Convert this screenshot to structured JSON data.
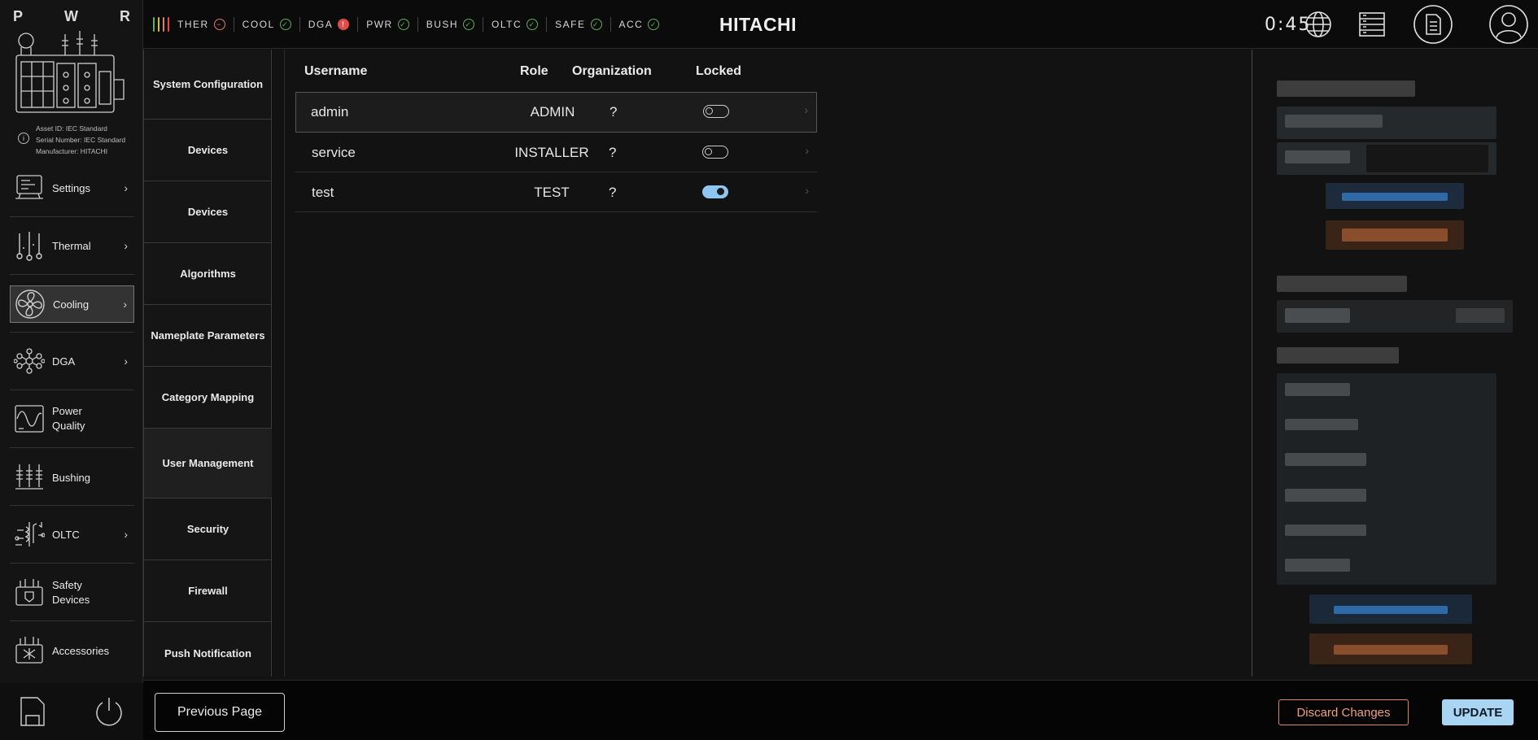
{
  "header": {
    "brand": "HITACHI",
    "timer": "0:45",
    "bar_colors": [
      "#5fae5a",
      "#c9c048",
      "#e07b66",
      "#e34a4a"
    ],
    "statuses": [
      {
        "label": "THER",
        "state": "warn",
        "glyph": "−"
      },
      {
        "label": "COOL",
        "state": "ok",
        "glyph": "✓"
      },
      {
        "label": "DGA",
        "state": "alert",
        "glyph": "!"
      },
      {
        "label": "PWR",
        "state": "ok",
        "glyph": "✓"
      },
      {
        "label": "BUSH",
        "state": "ok",
        "glyph": "✓"
      },
      {
        "label": "OLTC",
        "state": "ok",
        "glyph": "✓"
      },
      {
        "label": "SAFE",
        "state": "ok",
        "glyph": "✓"
      },
      {
        "label": "ACC",
        "state": "ok",
        "glyph": "✓"
      }
    ],
    "icons": [
      "globe-icon",
      "server-icon",
      "document-icon",
      "user-icon"
    ]
  },
  "asset": {
    "letters": [
      "P",
      "W",
      "R"
    ],
    "asset_id": "Asset ID: IEC Standard",
    "serial": "Serial Number: IEC Standard",
    "manufacturer": "Manufacturer: HITACHI"
  },
  "nav": {
    "items": [
      {
        "label": "Settings",
        "icon": "settings-icon",
        "chevron": true
      },
      {
        "label": "Thermal",
        "icon": "thermometer-icon",
        "chevron": true
      },
      {
        "label": "Cooling",
        "icon": "fan-icon",
        "chevron": true,
        "active": true
      },
      {
        "label": "DGA",
        "icon": "molecule-icon",
        "chevron": true
      },
      {
        "label": "Power\nQuality",
        "icon": "waveform-icon",
        "chevron": false
      },
      {
        "label": "Bushing",
        "icon": "bushing-icon",
        "chevron": false
      },
      {
        "label": "OLTC",
        "icon": "tap-changer-icon",
        "chevron": true
      },
      {
        "label": "Safety\nDevices",
        "icon": "safety-device-icon",
        "chevron": false
      },
      {
        "label": "Accessories",
        "icon": "accessories-icon",
        "chevron": false
      }
    ]
  },
  "subnav": {
    "items": [
      {
        "label": "System Configuration"
      },
      {
        "label": "Devices"
      },
      {
        "label": "Devices"
      },
      {
        "label": "Algorithms"
      },
      {
        "label": "Nameplate Parameters"
      },
      {
        "label": "Category Mapping"
      },
      {
        "label": "User Management",
        "active": true
      },
      {
        "label": "Security"
      },
      {
        "label": "Firewall"
      },
      {
        "label": "Push Notification"
      }
    ]
  },
  "table": {
    "headers": {
      "username": "Username",
      "role": "Role",
      "organization": "Organization",
      "locked": "Locked"
    },
    "rows": [
      {
        "username": "admin",
        "role": "ADMIN",
        "organization": "?",
        "locked": false
      },
      {
        "username": "service",
        "role": "INSTALLER",
        "organization": "?",
        "locked": false
      },
      {
        "username": "test",
        "role": "TEST",
        "organization": "?",
        "locked": true
      }
    ]
  },
  "footer": {
    "prev_label": "Previous Page",
    "discard_label": "Discard Changes",
    "update_label": "UPDATE"
  }
}
